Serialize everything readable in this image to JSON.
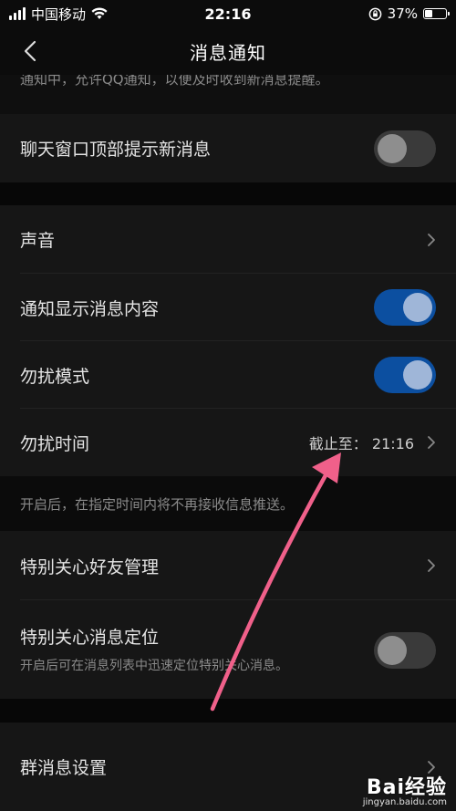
{
  "status_bar": {
    "carrier": "中国移动",
    "time": "22:16",
    "battery": "37%",
    "battery_level": 0.37
  },
  "nav": {
    "title": "消息通知"
  },
  "top_description": "通知中，允许QQ通知，以便及时收到新消息提醒。",
  "settings": {
    "chat_top_notify": {
      "label": "聊天窗口顶部提示新消息",
      "enabled": false
    },
    "sound": {
      "label": "声音"
    },
    "show_content": {
      "label": "通知显示消息内容",
      "enabled": true
    },
    "dnd_mode": {
      "label": "勿扰模式",
      "enabled": true
    },
    "dnd_time": {
      "label": "勿扰时间",
      "value": "截止至：  21:16"
    },
    "dnd_note": "开启后，在指定时间内将不再接收信息推送。",
    "special_friends": {
      "label": "特别关心好友管理"
    },
    "special_locate": {
      "label": "特别关心消息定位",
      "sub": "开启后可在消息列表中迅速定位特别关心消息。",
      "enabled": false
    },
    "group_settings": {
      "label": "群消息设置"
    }
  },
  "watermark": {
    "logo": "Bai经验",
    "url": "jingyan.baidu.com"
  },
  "colors": {
    "toggle_on": "#0c4fa0",
    "toggle_off": "#3a3a3a",
    "annotation_arrow": "#f0608a"
  }
}
